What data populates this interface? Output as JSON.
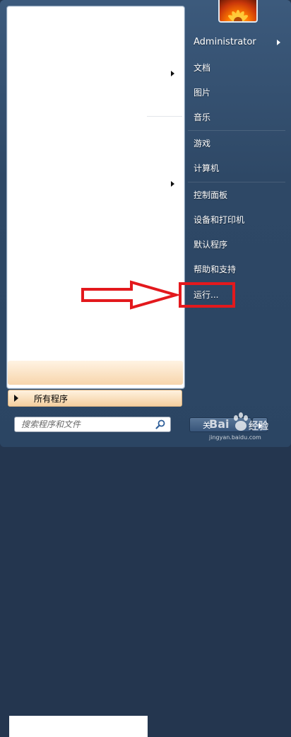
{
  "start_menu": {
    "all_programs_label": "所有程序",
    "search_placeholder": "搜索程序和文件",
    "right_items": [
      {
        "label": "Administrator"
      },
      {
        "label": "文档"
      },
      {
        "label": "图片"
      },
      {
        "label": "音乐"
      },
      {
        "label": "游戏"
      },
      {
        "label": "计算机"
      },
      {
        "label": "控制面板"
      },
      {
        "label": "设备和打印机"
      },
      {
        "label": "默认程序"
      },
      {
        "label": "帮助和支持"
      },
      {
        "label": "运行..."
      }
    ],
    "shutdown_label": "关"
  },
  "watermark": {
    "brand": "Bai",
    "suffix": "经验",
    "url": "jingyan.baidu.com"
  },
  "colors": {
    "highlight_red": "#e3191d",
    "accent_orange": "#f4cf9f"
  }
}
